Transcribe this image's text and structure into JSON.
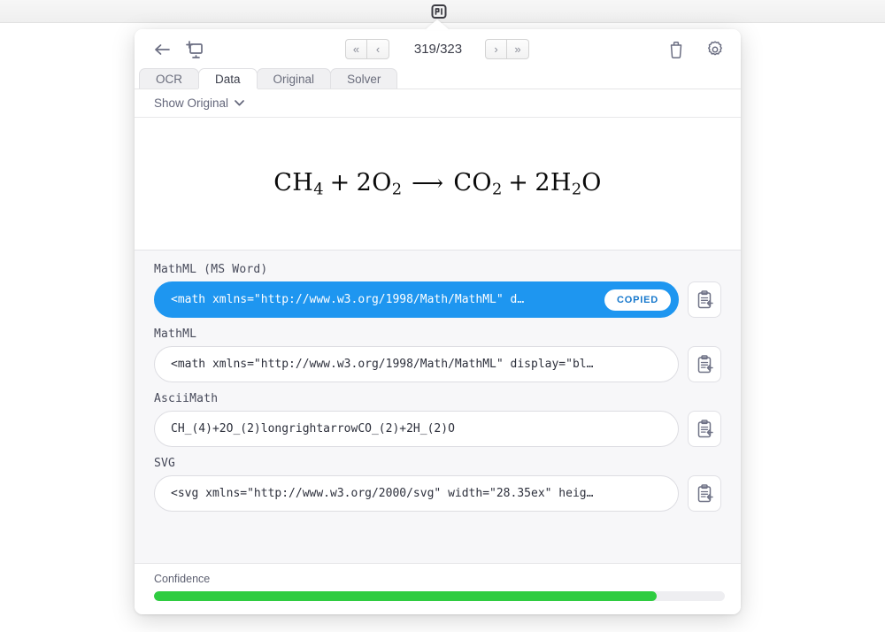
{
  "menubar": {
    "app_icon": "mathpix-snip-icon"
  },
  "toolbar": {
    "back_icon": "back-arrow-icon",
    "snip_icon": "new-snip-icon",
    "first_label": "«",
    "prev_label": "‹",
    "next_label": "›",
    "last_label": "»",
    "page_counter": "319/323",
    "delete_icon": "trash-icon",
    "settings_icon": "gear-icon"
  },
  "tabs": [
    {
      "label": "OCR",
      "active": false
    },
    {
      "label": "Data",
      "active": true
    },
    {
      "label": "Original",
      "active": false
    },
    {
      "label": "Solver",
      "active": false
    }
  ],
  "show_original": {
    "label": "Show Original",
    "chevron_icon": "chevron-down-icon"
  },
  "formula": {
    "description": "CH4 + 2O2 ⟶ CO2 + 2H2O",
    "terms": {
      "ch": "CH",
      "ch_sub": "4",
      "plus1": "+",
      "o_coeff": "2O",
      "o_sub": "2",
      "arrow": "⟶",
      "co": "CO",
      "co_sub": "2",
      "plus2": "+",
      "h_coeff": "2H",
      "h_sub": "2",
      "o_end": "O"
    }
  },
  "fields": [
    {
      "label": "MathML (MS Word)",
      "value": "<math xmlns=\"http://www.w3.org/1998/Math/MathML\" d…",
      "copied": true,
      "badge": "COPIED",
      "copy_icon": "copy-to-clipboard-icon"
    },
    {
      "label": "MathML",
      "value": "<math xmlns=\"http://www.w3.org/1998/Math/MathML\" display=\"bl…",
      "copied": false,
      "badge": "",
      "copy_icon": "copy-to-clipboard-icon"
    },
    {
      "label": "AsciiMath",
      "value": "CH_(4)+2O_(2)longrightarrowCO_(2)+2H_(2)O",
      "copied": false,
      "badge": "",
      "copy_icon": "copy-to-clipboard-icon"
    },
    {
      "label": "SVG",
      "value": "<svg xmlns=\"http://www.w3.org/2000/svg\" width=\"28.35ex\" heig…",
      "copied": false,
      "badge": "",
      "copy_icon": "copy-to-clipboard-icon"
    }
  ],
  "confidence": {
    "label": "Confidence",
    "percent": 88
  },
  "colors": {
    "accent_blue": "#1e96f0",
    "confidence_green": "#2ecc40",
    "panel_bg": "#ffffff",
    "results_bg": "#f7f7f9"
  }
}
